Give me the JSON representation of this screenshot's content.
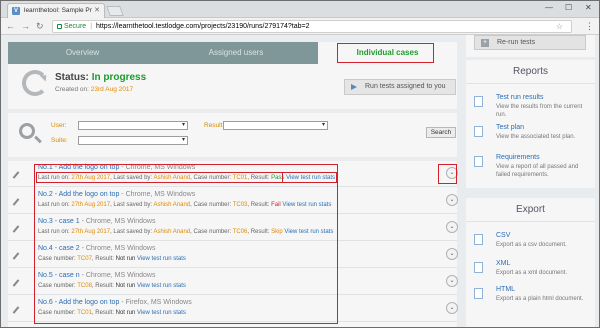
{
  "browser": {
    "tab_title": "learnthetool: Sample Pr",
    "tab_icon": "V",
    "secure_label": "Secure",
    "url": "https://learnthetool.testlodge.com/projects/23190/runs/279174?tab=2",
    "window_controls": [
      "—",
      "☐",
      "✕"
    ]
  },
  "tabs": {
    "overview": "Overview",
    "assigned": "Assigned users",
    "individual": "Individual cases"
  },
  "status": {
    "label": "Status:",
    "value": "In progress",
    "created_prefix": "Created on:",
    "created_date": "23rd Aug 2017",
    "run_button": "Run tests assigned to you"
  },
  "filters": {
    "user_label": "User:",
    "result_label": "Result:",
    "suite_label": "Suite:",
    "search_button": "Search"
  },
  "cases": [
    {
      "title": "No.1 - Add the logo on top",
      "env": " - Chrome, MS Windows",
      "m1": "Last run on: ",
      "date": "27th Aug 2017",
      "m2": ", Last saved by: ",
      "user": "Ashish Anand",
      "m3": ", Case number: ",
      "case": "TC01",
      "m4": ", Result: ",
      "result": "Pass",
      "link": "View test run stats"
    },
    {
      "title": "No.2 - Add the logo on top",
      "env": " - Chrome, MS Windows",
      "m1": "Last run on: ",
      "date": "27th Aug 2017",
      "m2": ", Last saved by: ",
      "user": "Ashish Anand",
      "m3": ", Case number: ",
      "case": "TC03",
      "m4": ", Result: ",
      "result": "Fail",
      "link": "View test run stats"
    },
    {
      "title": "No.3 - case 1",
      "env": " - Chrome, MS Windows",
      "m1": "Last run on: ",
      "date": "27th Aug 2017",
      "m2": ", Last saved by: ",
      "user": "Ashish Anand",
      "m3": ", Case number: ",
      "case": "TC06",
      "m4": ", Result: ",
      "result": "Skip",
      "link": "View test run stats"
    },
    {
      "title": "No.4 - case 2",
      "env": " - Chrome, MS Windows",
      "m1": "",
      "date": "",
      "m2": "",
      "user": "",
      "m3": "Case number: ",
      "case": "TC07",
      "m4": ", Result: ",
      "result": "Not run",
      "link": "View test run stats"
    },
    {
      "title": "No.5 - case n",
      "env": " - Chrome, MS Windows",
      "m1": "",
      "date": "",
      "m2": "",
      "user": "",
      "m3": "Case number: ",
      "case": "TC08",
      "m4": ", Result: ",
      "result": "Not run",
      "link": "View test run stats"
    },
    {
      "title": "No.6 - Add the logo on top",
      "env": " - Firefox, MS Windows",
      "m1": "",
      "date": "",
      "m2": "",
      "user": "",
      "m3": "Case number: ",
      "case": "TC01",
      "m4": ", Result: ",
      "result": "Not run",
      "link": "View test run stats"
    }
  ],
  "sidebar": {
    "rerun_button": "Re-run tests",
    "reports_heading": "Reports",
    "reports": [
      {
        "link": "Test run results",
        "desc": "View the results from the current run."
      },
      {
        "link": "Test plan",
        "desc": "View the associated test plan."
      },
      {
        "link": "Requirements",
        "desc": "View a report of all passed and failed requirements."
      }
    ],
    "export_heading": "Export",
    "exports": [
      {
        "link": "CSV",
        "desc": "Export as a csv document."
      },
      {
        "link": "XML",
        "desc": "Export as a xml document."
      },
      {
        "link": "HTML",
        "desc": "Export as a plain html document."
      }
    ]
  },
  "colors": {
    "accent_green": "#1c9c2b",
    "highlight_red": "#d4202b",
    "link_blue": "#2b6db3",
    "meta_orange": "#e18a00",
    "tab_bar": "#7f9798"
  }
}
